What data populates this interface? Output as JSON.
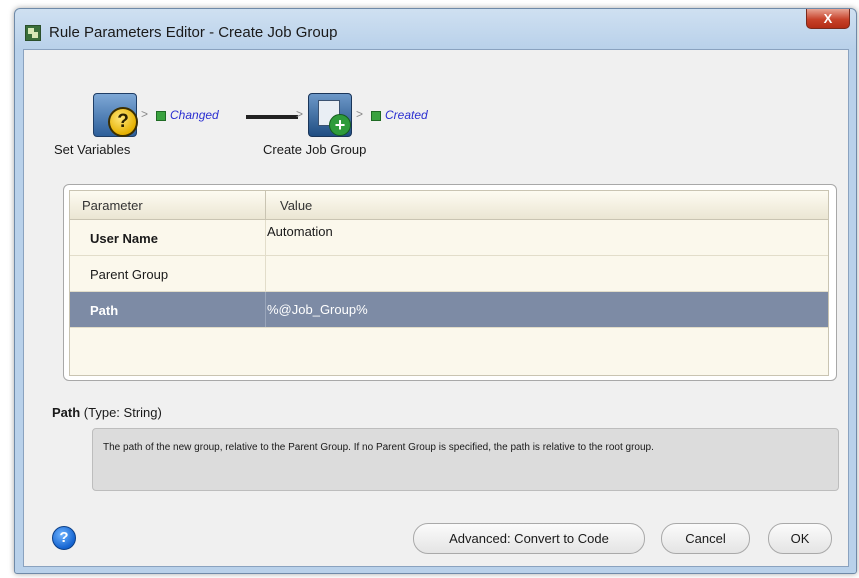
{
  "window": {
    "title": "Rule Parameters Editor - Create Job Group",
    "close_glyph": "X"
  },
  "workflow": {
    "steps": [
      {
        "label": "Set Variables",
        "icon": "set-variables-icon",
        "status": "Changed"
      },
      {
        "label": "Create Job Group",
        "icon": "create-job-group-icon",
        "status": "Created"
      }
    ],
    "arrow_glyph": ">"
  },
  "table": {
    "headers": {
      "parameter": "Parameter",
      "value": "Value"
    },
    "rows": [
      {
        "name": "User Name",
        "value": "Automation"
      },
      {
        "name": "Parent Group",
        "value": ""
      },
      {
        "name": "Path",
        "value": "%@Job_Group%"
      }
    ]
  },
  "description": {
    "name": "Path",
    "type": "(Type: String)",
    "text": "The path of the new group, relative to the Parent Group. If no Parent Group is specified, the path is relative to the root group."
  },
  "footer": {
    "help_glyph": "?",
    "advanced_label": "Advanced: Convert to Code",
    "cancel_label": "Cancel",
    "ok_label": "OK"
  },
  "colors": {
    "selected_row": "#7d8ba5",
    "status_text": "#2b2fd1",
    "status_check": "#3aa23f"
  }
}
